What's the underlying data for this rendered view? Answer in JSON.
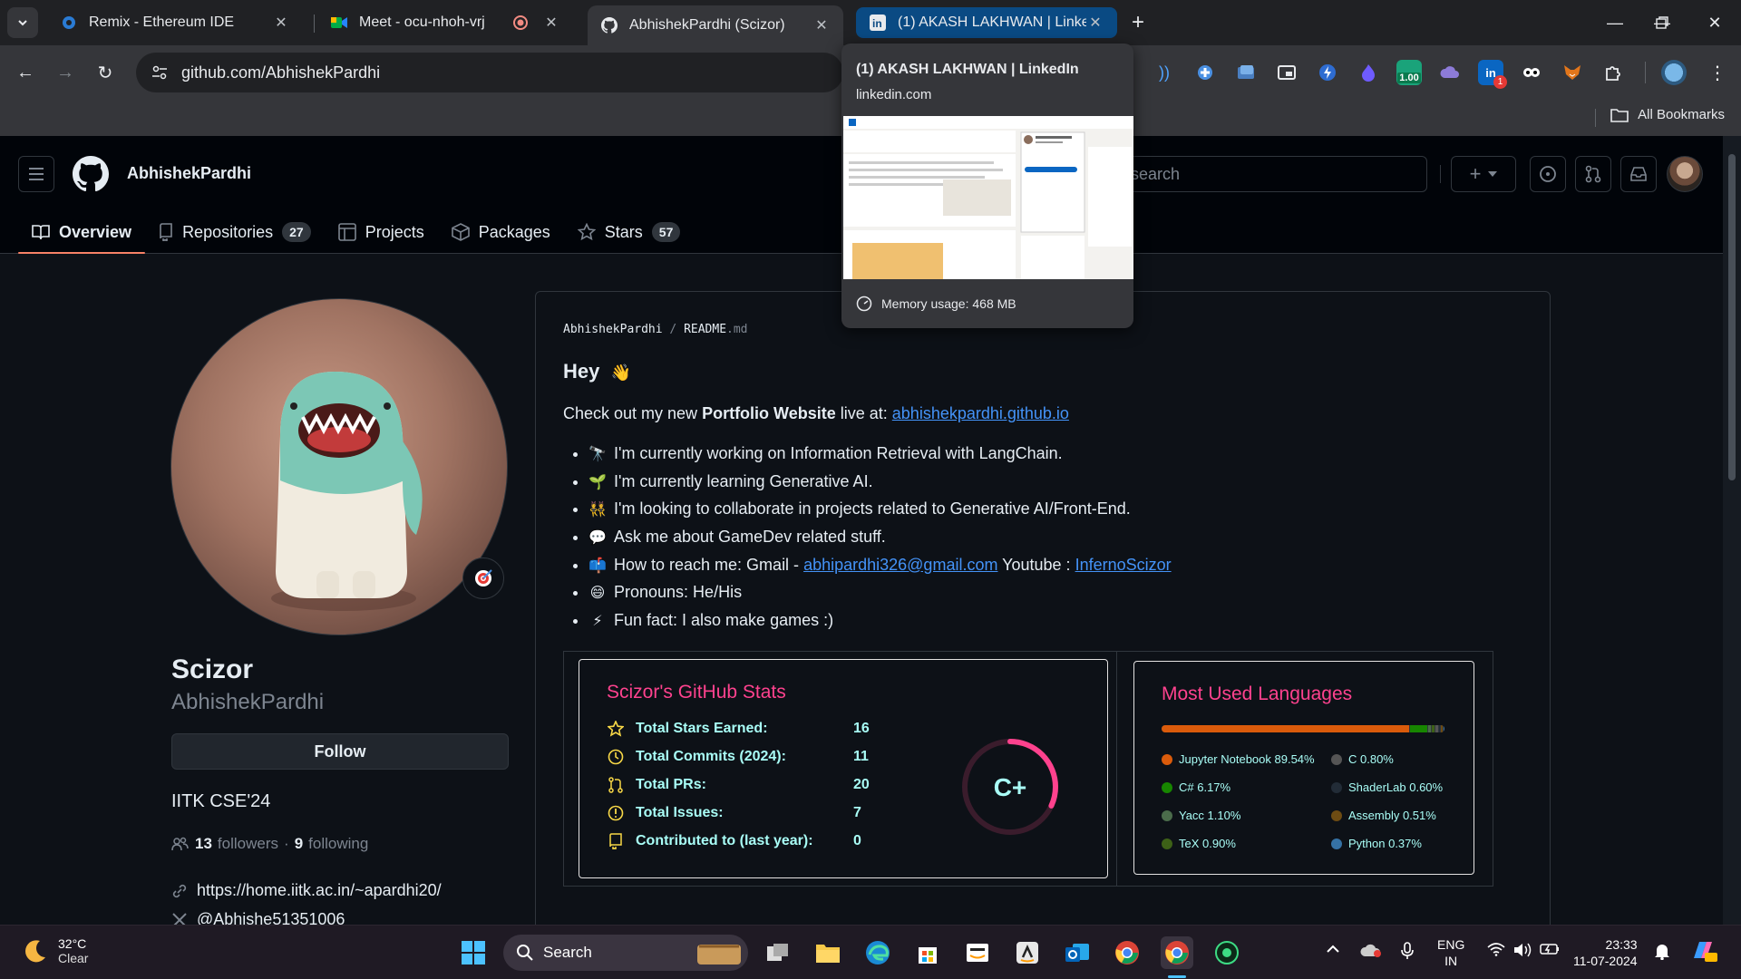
{
  "browser": {
    "tabs": [
      {
        "title": "Remix - Ethereum IDE"
      },
      {
        "title": "Meet - ocu-nhoh-vrj"
      },
      {
        "title": "AbhishekPardhi (Scizor)"
      },
      {
        "title": "(1) AKASH LAKHWAN | LinkedIn"
      }
    ],
    "url": "github.com/AbhishekPardhi",
    "ext_badge_value": "1.00",
    "ext_badge_count": "1",
    "all_bookmarks": "All Bookmarks"
  },
  "hovercard": {
    "title": "(1) AKASH LAKHWAN | LinkedIn",
    "domain": "linkedin.com",
    "memory": "Memory usage: 468 MB"
  },
  "github": {
    "username": "AbhishekPardhi",
    "search_placeholder": "search",
    "tabs": [
      {
        "label": "Overview",
        "count": ""
      },
      {
        "label": "Repositories",
        "count": "27"
      },
      {
        "label": "Projects",
        "count": ""
      },
      {
        "label": "Packages",
        "count": ""
      },
      {
        "label": "Stars",
        "count": "57"
      }
    ]
  },
  "profile": {
    "name": "Scizor",
    "login": "AbhishekPardhi",
    "follow_label": "Follow",
    "bio": "IITK CSE'24",
    "followers": "13",
    "followers_label": "followers",
    "following": "9",
    "following_label": "following",
    "website": "https://home.iitk.ac.in/~apardhi20/",
    "twitter": "@Abhishe51351006"
  },
  "readme": {
    "owner": "AbhishekPardhi",
    "file": "README",
    "ext": ".md",
    "greeting": "Hey",
    "greeting_emoji": "👋",
    "intro_pre": "Check out my new ",
    "intro_bold": "Portfolio Website",
    "intro_mid": " live at: ",
    "intro_link": "abhishekpardhi.github.io",
    "items": [
      {
        "emoji": "🔭",
        "text": "I'm currently working on Information Retrieval with LangChain."
      },
      {
        "emoji": "🌱",
        "text": "I'm currently learning Generative AI."
      },
      {
        "emoji": "👯",
        "text": "I'm looking to collaborate in projects related to Generative AI/Front-End."
      },
      {
        "emoji": "💬",
        "text": "Ask me about GameDev related stuff."
      },
      {
        "emoji": "📫",
        "text": "How to reach me: Gmail - ",
        "link1": "abhipardhi326@gmail.com",
        "mid": " Youtube : ",
        "link2": "InfernoScizor"
      },
      {
        "emoji": "😄",
        "text": "Pronouns: He/His"
      },
      {
        "emoji": "⚡",
        "text": "Fun fact: I also make games :)"
      }
    ]
  },
  "stats": {
    "title": "Scizor's GitHub Stats",
    "rows": [
      {
        "label": "Total Stars Earned:",
        "value": "16"
      },
      {
        "label": "Total Commits (2024):",
        "value": "11"
      },
      {
        "label": "Total PRs:",
        "value": "20"
      },
      {
        "label": "Total Issues:",
        "value": "7"
      },
      {
        "label": "Contributed to (last year):",
        "value": "0"
      }
    ],
    "grade": "C+",
    "ring_color": "#fe428e"
  },
  "languages": {
    "title": "Most Used Languages",
    "items": [
      {
        "label": "Jupyter Notebook 89.54%",
        "percent": 89.54,
        "color": "#DA5B0B"
      },
      {
        "label": "C# 6.17%",
        "percent": 6.17,
        "color": "#178600"
      },
      {
        "label": "Yacc 1.10%",
        "percent": 1.1,
        "color": "#4B6C4B"
      },
      {
        "label": "TeX 0.90%",
        "percent": 0.9,
        "color": "#3D6117"
      },
      {
        "label": "C 0.80%",
        "percent": 0.8,
        "color": "#555555"
      },
      {
        "label": "ShaderLab 0.60%",
        "percent": 0.6,
        "color": "#222c37"
      },
      {
        "label": "Assembly 0.51%",
        "percent": 0.51,
        "color": "#6E4C13"
      },
      {
        "label": "Python 0.37%",
        "percent": 0.37,
        "color": "#3572A5"
      }
    ]
  },
  "taskbar": {
    "temp": "32°C",
    "condition": "Clear",
    "search": "Search",
    "lang1": "ENG",
    "lang2": "IN",
    "time": "23:33",
    "date": "11-07-2024"
  },
  "colors": {
    "accent_underline": "#f78166",
    "link": "#4493f8",
    "card_title": "#fe428e",
    "card_text": "#a9fef7",
    "card_icon": "#f8d847"
  }
}
